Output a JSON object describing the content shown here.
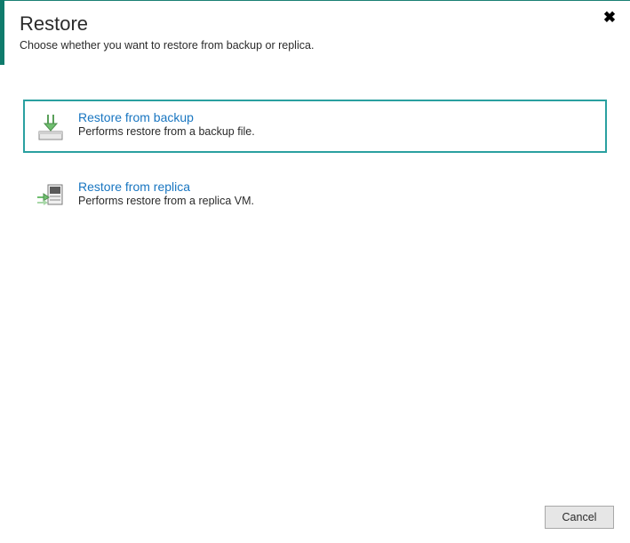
{
  "header": {
    "title": "Restore",
    "subtitle": "Choose whether you want to restore from backup or replica."
  },
  "options": [
    {
      "title": "Restore from backup",
      "description": "Performs restore from a backup file.",
      "selected": true,
      "icon": "restore-backup-icon"
    },
    {
      "title": "Restore from replica",
      "description": "Performs restore from a replica VM.",
      "selected": false,
      "icon": "restore-replica-icon"
    }
  ],
  "footer": {
    "cancel_label": "Cancel"
  }
}
